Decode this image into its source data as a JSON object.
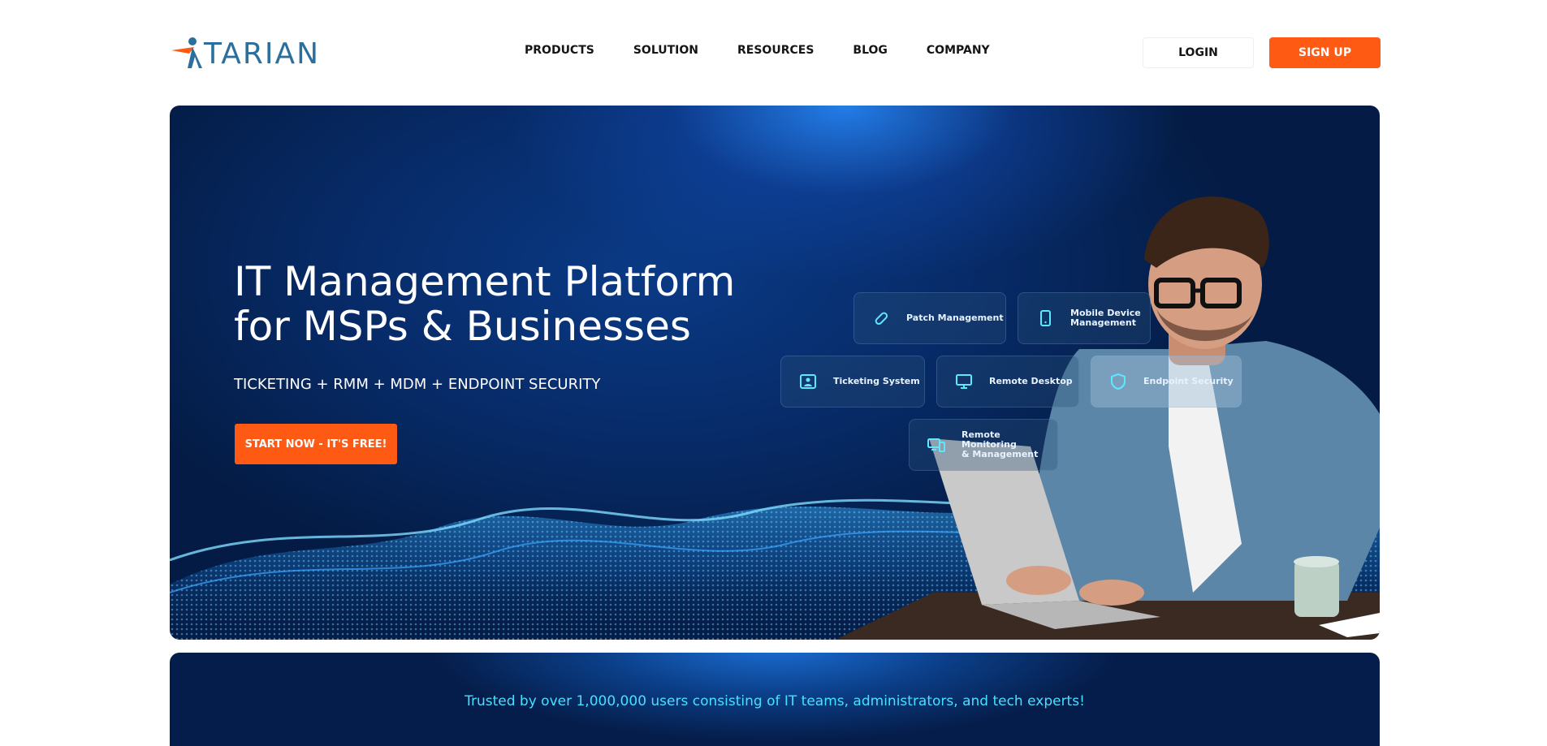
{
  "brand": {
    "name": "TARIAN"
  },
  "nav": {
    "items": [
      {
        "label": "PRODUCTS"
      },
      {
        "label": "SOLUTION"
      },
      {
        "label": "RESOURCES"
      },
      {
        "label": "BLOG"
      },
      {
        "label": "COMPANY"
      }
    ]
  },
  "header": {
    "login_label": "LOGIN",
    "signup_label": "SIGN UP"
  },
  "hero": {
    "title_line1": "IT Management Platform",
    "title_line2": "for MSPs & Businesses",
    "subtitle": "TICKETING + RMM + MDM + ENDPOINT SECURITY",
    "cta_label": "START NOW - IT'S FREE!",
    "features": [
      {
        "label": "Patch Management",
        "icon": "bandage-icon"
      },
      {
        "label": "Mobile Device\nManagement",
        "icon": "mobile-icon"
      },
      {
        "label": "Ticketing System",
        "icon": "ticket-icon"
      },
      {
        "label": "Remote Desktop",
        "icon": "monitor-icon"
      },
      {
        "label": "Endpoint Security",
        "icon": "shield-icon"
      },
      {
        "label": "Remote Monitoring\n& Management",
        "icon": "devices-icon"
      }
    ]
  },
  "trust": {
    "text": "Trusted by over 1,000,000 users consisting of IT teams, administrators, and tech experts!"
  },
  "colors": {
    "accent": "#ff5a14",
    "brand_blue": "#2b6f9e",
    "hero_bg": "#072a66",
    "trust_text": "#46e0ff"
  }
}
